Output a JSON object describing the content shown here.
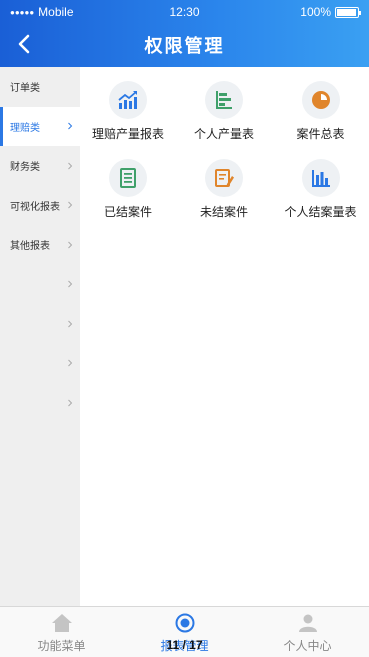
{
  "status_bar": {
    "signal_dots": "●●●●●",
    "carrier": "Mobile",
    "time": "12:30",
    "battery": "100%",
    "battery_level": 1.0
  },
  "header": {
    "title": "权限管理",
    "back_icon": "chevron-left-icon"
  },
  "sidebar": {
    "items": [
      {
        "label": "订单类",
        "chevron": false,
        "active": false
      },
      {
        "label": "理赔类",
        "chevron": true,
        "active": true
      },
      {
        "label": "财务类",
        "chevron": true,
        "active": false
      },
      {
        "label": "可视化报表",
        "chevron": true,
        "active": false
      },
      {
        "label": "其他报表",
        "chevron": true,
        "active": false
      },
      {
        "label": "",
        "chevron": true,
        "active": false
      },
      {
        "label": "",
        "chevron": true,
        "active": false
      },
      {
        "label": "",
        "chevron": true,
        "active": false
      },
      {
        "label": "",
        "chevron": true,
        "active": false
      }
    ]
  },
  "reports": [
    {
      "label": "理赔产量报表",
      "icon": "bar-chart-trend-icon",
      "color": "#2b78e4"
    },
    {
      "label": "个人产量表",
      "icon": "horizontal-bars-icon",
      "color": "#3fa06a"
    },
    {
      "label": "案件总表",
      "icon": "pie-chart-icon",
      "color": "#e0852b"
    },
    {
      "label": "已结案件",
      "icon": "document-list-icon",
      "color": "#3fa06a"
    },
    {
      "label": "未结案件",
      "icon": "edit-document-icon",
      "color": "#e0852b"
    },
    {
      "label": "个人结案量表",
      "icon": "column-chart-icon",
      "color": "#2b78e4"
    }
  ],
  "tabbar": {
    "tabs": [
      {
        "label": "功能菜单",
        "icon": "home-icon",
        "active": false
      },
      {
        "label": "报表管理",
        "icon": "target-icon",
        "active": true
      },
      {
        "label": "个人中心",
        "icon": "person-icon",
        "active": false
      }
    ],
    "pager": "11 / 17"
  },
  "colors": {
    "header_start": "#1a5fd6",
    "header_end": "#3aa0f2",
    "accent": "#2b78e4",
    "sidebar_bg": "#efefef"
  }
}
